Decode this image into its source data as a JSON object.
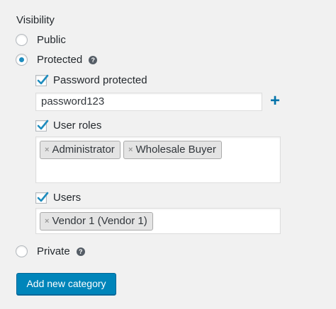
{
  "visibility": {
    "heading": "Visibility",
    "options": {
      "public": "Public",
      "protected": "Protected",
      "private": "Private"
    },
    "selected": "Protected",
    "help_icon": "?"
  },
  "protected": {
    "password_protected_label": "Password protected",
    "password_protected_checked": true,
    "password_value": "password123",
    "add_password_glyph": "+",
    "user_roles_label": "User roles",
    "user_roles_checked": true,
    "user_roles": [
      "Administrator",
      "Wholesale Buyer"
    ],
    "users_label": "Users",
    "users_checked": true,
    "users": [
      "Vendor 1 (Vendor 1)"
    ],
    "remove_glyph": "×"
  },
  "actions": {
    "add_category_label": "Add new category"
  },
  "colors": {
    "accent": "#0085ba",
    "radio_dot": "#1e8cbe",
    "checkmark": "#1e8cbe",
    "plus": "#0073aa"
  }
}
